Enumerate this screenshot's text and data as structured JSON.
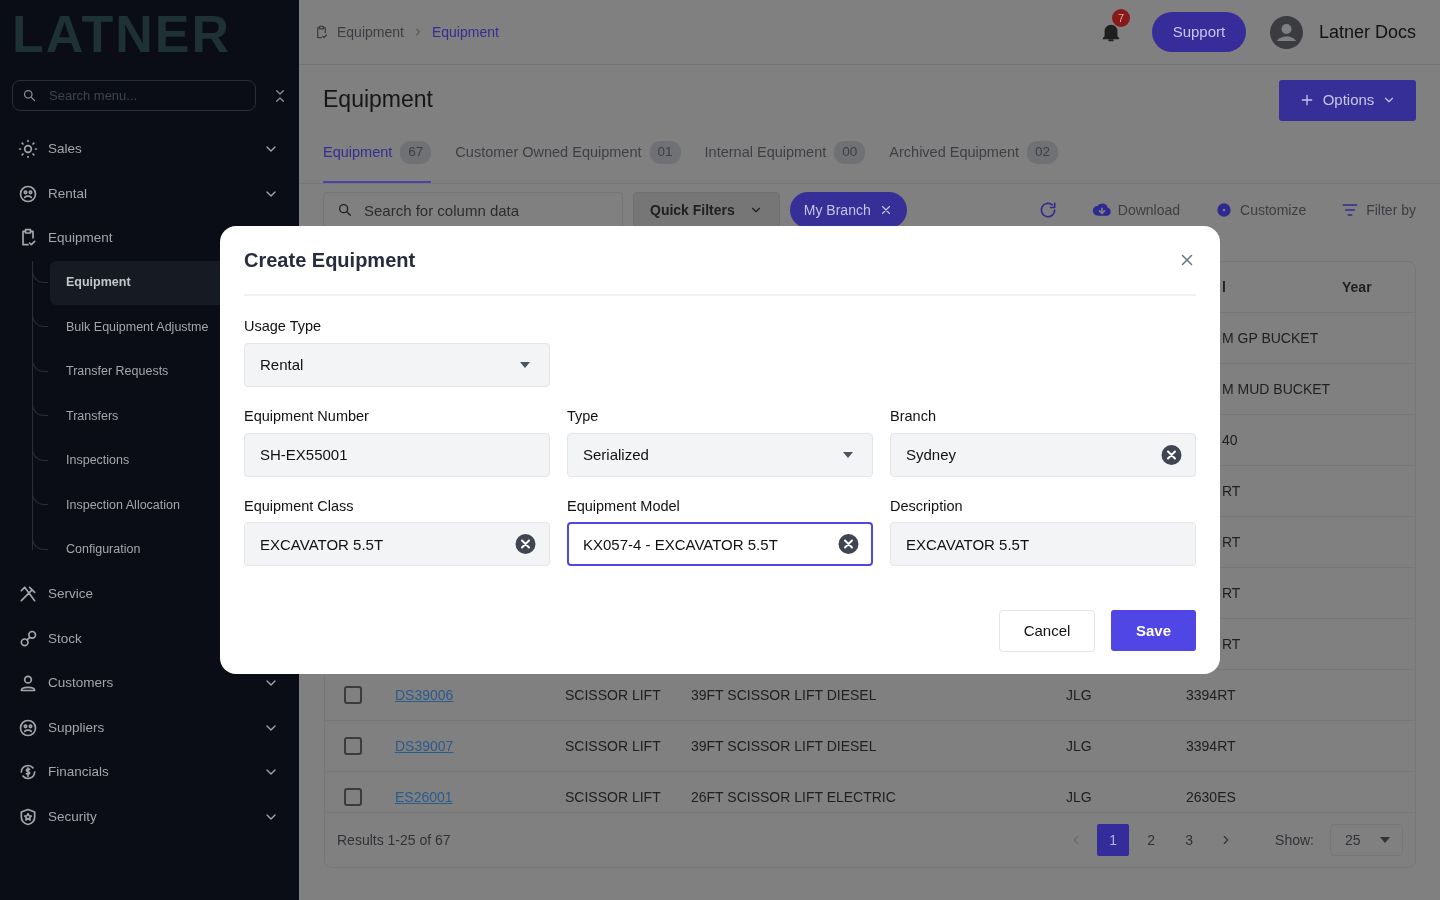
{
  "sidebar": {
    "logo": "LATNER",
    "search": {
      "placeholder": "Search menu..."
    },
    "items": [
      {
        "label": "Sales",
        "kind": "group",
        "expanded": false
      },
      {
        "label": "Rental",
        "kind": "group",
        "expanded": false
      },
      {
        "label": "Equipment",
        "kind": "group",
        "expanded": true,
        "children": [
          {
            "label": "Equipment",
            "selected": true
          },
          {
            "label": "Bulk Equipment Adjustme",
            "selected": false
          },
          {
            "label": "Transfer Requests",
            "selected": false
          },
          {
            "label": "Transfers",
            "selected": false
          },
          {
            "label": "Inspections",
            "selected": false
          },
          {
            "label": "Inspection Allocation",
            "selected": false
          },
          {
            "label": "Configuration",
            "selected": false
          }
        ]
      },
      {
        "label": "Service",
        "kind": "link"
      },
      {
        "label": "Stock",
        "kind": "link"
      },
      {
        "label": "Customers",
        "kind": "group",
        "expanded": false
      },
      {
        "label": "Suppliers",
        "kind": "group",
        "expanded": false
      },
      {
        "label": "Financials",
        "kind": "group",
        "expanded": false
      },
      {
        "label": "Security",
        "kind": "group",
        "expanded": false
      }
    ]
  },
  "header": {
    "breadcrumb": [
      "Equipment",
      "Equipment"
    ],
    "notifications": "7",
    "support": "Support",
    "user": "Latner Docs"
  },
  "page": {
    "title": "Equipment",
    "options": "Options",
    "tabs": [
      {
        "label": "Equipment",
        "count": "67",
        "selected": true
      },
      {
        "label": "Customer Owned Equipment",
        "count": "01",
        "selected": false
      },
      {
        "label": "Internal Equipment",
        "count": "00",
        "selected": false
      },
      {
        "label": "Archived Equipment",
        "count": "02",
        "selected": false
      }
    ],
    "toolbar": {
      "search_placeholder": "Search for column data",
      "quick_filters": "Quick Filters",
      "chip": "My Branch",
      "download": "Download",
      "customize": "Customize",
      "filter": "Filter by"
    }
  },
  "table": {
    "columns": {
      "column_6": "l",
      "year": "Year"
    },
    "rows": [
      {
        "kind": "partial",
        "column_6": "M GP BUCKET"
      },
      {
        "kind": "partial",
        "column_6": "M MUD BUCKET"
      },
      {
        "kind": "partial",
        "column_6": "40"
      },
      {
        "kind": "partial",
        "column_6": "RT"
      },
      {
        "kind": "partial",
        "column_6": "RT"
      },
      {
        "kind": "partial",
        "column_6": "RT"
      },
      {
        "kind": "partial",
        "column_6": "RT"
      },
      {
        "kind": "full",
        "checked": false,
        "number": "DS39006",
        "class": "SCISSOR LIFT",
        "description": "39FT SCISSOR LIFT DIESEL",
        "make": "JLG",
        "model": "3394RT"
      },
      {
        "kind": "full",
        "checked": false,
        "number": "DS39007",
        "class": "SCISSOR LIFT",
        "description": "39FT SCISSOR LIFT DIESEL",
        "make": "JLG",
        "model": "3394RT"
      },
      {
        "kind": "full",
        "checked": false,
        "number": "ES26001",
        "class": "SCISSOR LIFT",
        "description": "26FT SCISSOR LIFT ELECTRIC",
        "make": "JLG",
        "model": "2630ES"
      }
    ],
    "footer": {
      "results": "Results 1-25 of 67",
      "pages": [
        {
          "label": "1",
          "selected": true
        },
        {
          "label": "2",
          "selected": false
        },
        {
          "label": "3",
          "selected": false
        }
      ],
      "show_label": "Show:",
      "show_value": "25"
    }
  },
  "modal": {
    "title": "Create Equipment",
    "rows": [
      [
        {
          "label": "Usage Type",
          "kind": "select",
          "value": "Rental",
          "focused": false
        }
      ],
      [
        {
          "label": "Equipment Number",
          "kind": "text",
          "value": "SH-EX55001",
          "focused": false
        },
        {
          "label": "Type",
          "kind": "select",
          "value": "Serialized",
          "focused": false
        },
        {
          "label": "Branch",
          "kind": "clearable",
          "value": "Sydney",
          "focused": false
        }
      ],
      [
        {
          "label": "Equipment Class",
          "kind": "clearable",
          "value": "EXCAVATOR 5.5T",
          "focused": false
        },
        {
          "label": "Equipment Model",
          "kind": "clearable",
          "value": "KX057-4 - EXCAVATOR 5.5T",
          "focused": true
        },
        {
          "label": "Description",
          "kind": "text",
          "value": "EXCAVATOR 5.5T",
          "focused": false
        }
      ]
    ],
    "cancel": "Cancel",
    "save": "Save"
  }
}
